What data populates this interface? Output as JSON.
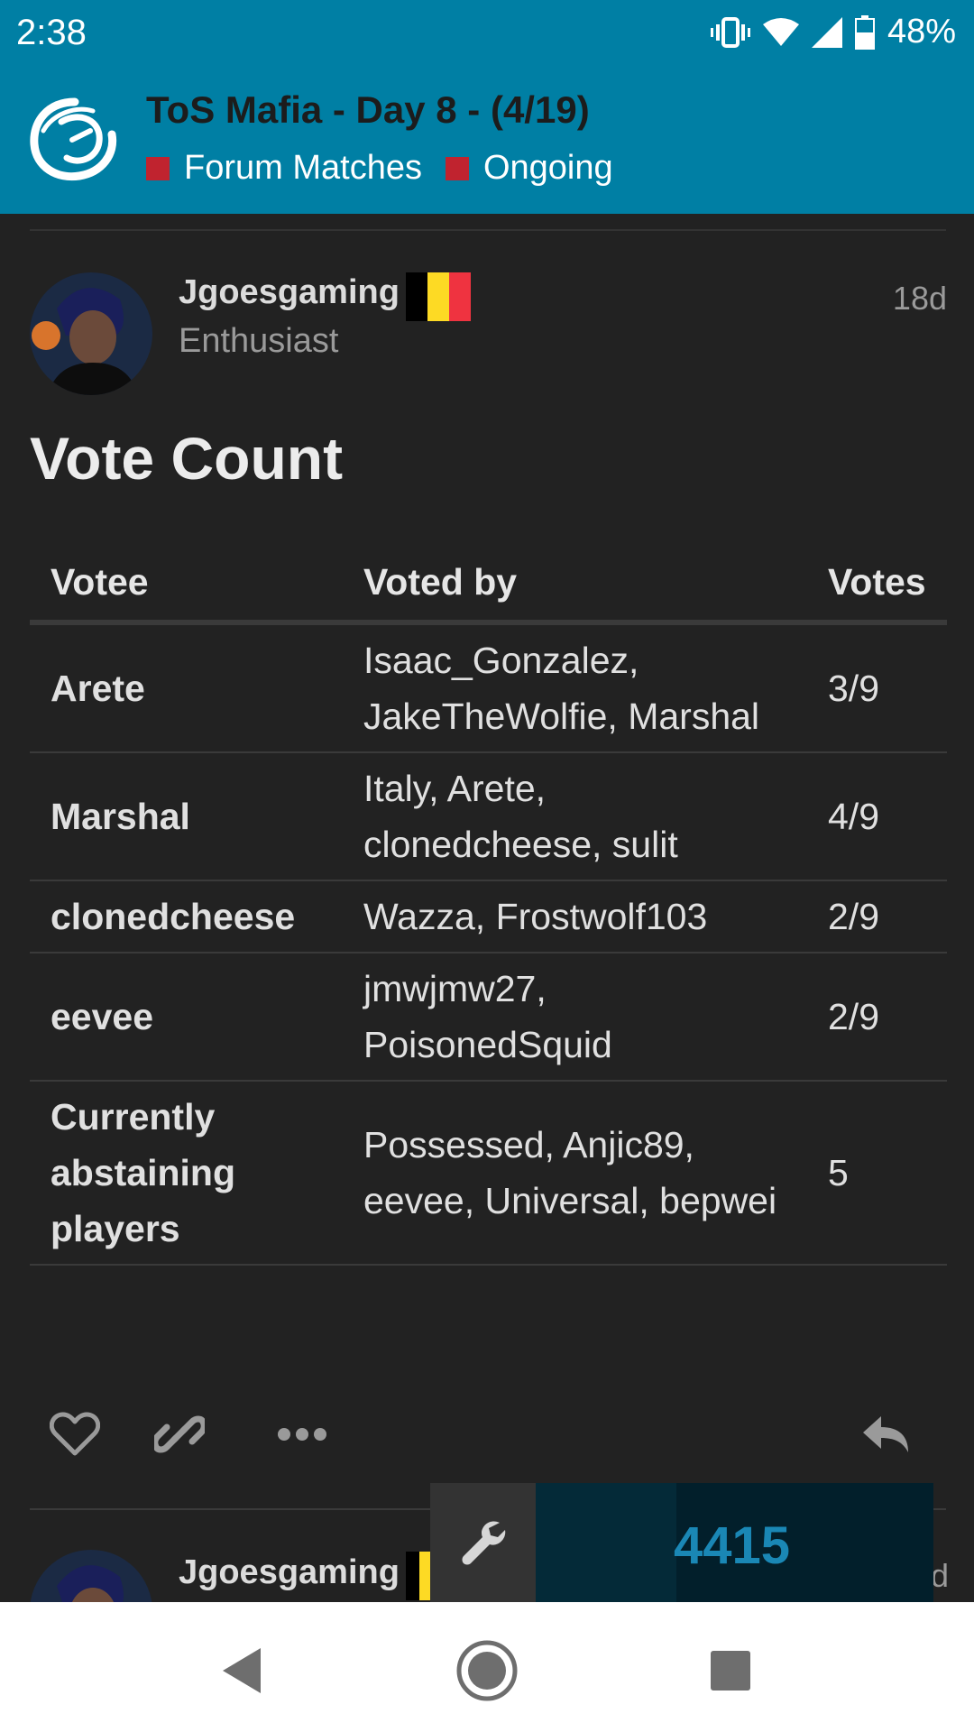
{
  "status_bar": {
    "time": "2:38",
    "battery": "48%",
    "icons": [
      "vibrate-icon",
      "wifi-icon",
      "signal-icon",
      "battery-icon"
    ]
  },
  "topic": {
    "title": "ToS Mafia - Day 8 - (4/19)",
    "categories": [
      {
        "label": "Forum Matches",
        "color": "#c0232f"
      },
      {
        "label": "Ongoing",
        "color": "#c0232f"
      }
    ]
  },
  "post": {
    "username": "Jgoesgaming",
    "user_title": "Enthusiast",
    "date": "18d",
    "heading": "Vote Count",
    "table": {
      "headers": [
        "Votee",
        "Voted by",
        "Votes"
      ],
      "rows": [
        {
          "votee": "Arete",
          "voted_by": "Isaac_Gonzalez, JakeTheWolfie, Marshal",
          "votes": "3/9"
        },
        {
          "votee": "Marshal",
          "voted_by": "Italy, Arete, clonedcheese, sulit",
          "votes": "4/9"
        },
        {
          "votee": "clonedcheese",
          "voted_by": "Wazza, Frostwolf103",
          "votes": "2/9"
        },
        {
          "votee": "eevee",
          "voted_by": "jmwjmw27, PoisonedSquid",
          "votes": "2/9"
        },
        {
          "votee": "Currently abstaining players",
          "voted_by": "Possessed, Anjic89, eevee, Universal, bepwei",
          "votes": "5"
        }
      ]
    },
    "actions": [
      "heart-icon",
      "link-icon",
      "more-icon",
      "reply-icon"
    ]
  },
  "next_post": {
    "username": "Jgoesgaming",
    "date_fragment": "d"
  },
  "widget": {
    "value": "4415",
    "icon": "wrench-icon"
  },
  "colors": {
    "header_bg": "#007fa4",
    "body_bg": "#222222",
    "category": "#c0232f",
    "widget_number": "#1a87b5"
  }
}
